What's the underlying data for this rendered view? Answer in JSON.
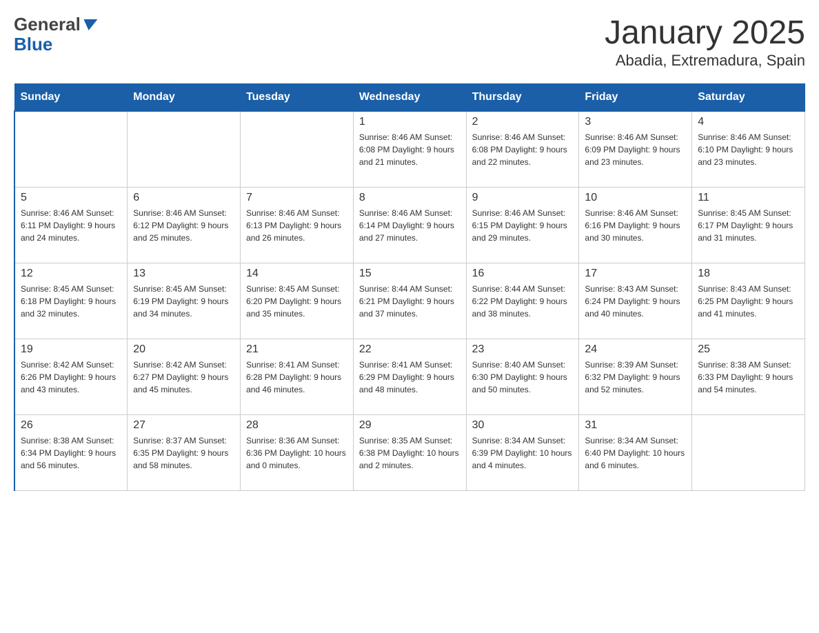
{
  "header": {
    "logo_general": "General",
    "logo_blue": "Blue",
    "title": "January 2025",
    "subtitle": "Abadia, Extremadura, Spain"
  },
  "days_of_week": [
    "Sunday",
    "Monday",
    "Tuesday",
    "Wednesday",
    "Thursday",
    "Friday",
    "Saturday"
  ],
  "weeks": [
    [
      {
        "day": "",
        "info": ""
      },
      {
        "day": "",
        "info": ""
      },
      {
        "day": "",
        "info": ""
      },
      {
        "day": "1",
        "info": "Sunrise: 8:46 AM\nSunset: 6:08 PM\nDaylight: 9 hours and 21 minutes."
      },
      {
        "day": "2",
        "info": "Sunrise: 8:46 AM\nSunset: 6:08 PM\nDaylight: 9 hours and 22 minutes."
      },
      {
        "day": "3",
        "info": "Sunrise: 8:46 AM\nSunset: 6:09 PM\nDaylight: 9 hours and 23 minutes."
      },
      {
        "day": "4",
        "info": "Sunrise: 8:46 AM\nSunset: 6:10 PM\nDaylight: 9 hours and 23 minutes."
      }
    ],
    [
      {
        "day": "5",
        "info": "Sunrise: 8:46 AM\nSunset: 6:11 PM\nDaylight: 9 hours and 24 minutes."
      },
      {
        "day": "6",
        "info": "Sunrise: 8:46 AM\nSunset: 6:12 PM\nDaylight: 9 hours and 25 minutes."
      },
      {
        "day": "7",
        "info": "Sunrise: 8:46 AM\nSunset: 6:13 PM\nDaylight: 9 hours and 26 minutes."
      },
      {
        "day": "8",
        "info": "Sunrise: 8:46 AM\nSunset: 6:14 PM\nDaylight: 9 hours and 27 minutes."
      },
      {
        "day": "9",
        "info": "Sunrise: 8:46 AM\nSunset: 6:15 PM\nDaylight: 9 hours and 29 minutes."
      },
      {
        "day": "10",
        "info": "Sunrise: 8:46 AM\nSunset: 6:16 PM\nDaylight: 9 hours and 30 minutes."
      },
      {
        "day": "11",
        "info": "Sunrise: 8:45 AM\nSunset: 6:17 PM\nDaylight: 9 hours and 31 minutes."
      }
    ],
    [
      {
        "day": "12",
        "info": "Sunrise: 8:45 AM\nSunset: 6:18 PM\nDaylight: 9 hours and 32 minutes."
      },
      {
        "day": "13",
        "info": "Sunrise: 8:45 AM\nSunset: 6:19 PM\nDaylight: 9 hours and 34 minutes."
      },
      {
        "day": "14",
        "info": "Sunrise: 8:45 AM\nSunset: 6:20 PM\nDaylight: 9 hours and 35 minutes."
      },
      {
        "day": "15",
        "info": "Sunrise: 8:44 AM\nSunset: 6:21 PM\nDaylight: 9 hours and 37 minutes."
      },
      {
        "day": "16",
        "info": "Sunrise: 8:44 AM\nSunset: 6:22 PM\nDaylight: 9 hours and 38 minutes."
      },
      {
        "day": "17",
        "info": "Sunrise: 8:43 AM\nSunset: 6:24 PM\nDaylight: 9 hours and 40 minutes."
      },
      {
        "day": "18",
        "info": "Sunrise: 8:43 AM\nSunset: 6:25 PM\nDaylight: 9 hours and 41 minutes."
      }
    ],
    [
      {
        "day": "19",
        "info": "Sunrise: 8:42 AM\nSunset: 6:26 PM\nDaylight: 9 hours and 43 minutes."
      },
      {
        "day": "20",
        "info": "Sunrise: 8:42 AM\nSunset: 6:27 PM\nDaylight: 9 hours and 45 minutes."
      },
      {
        "day": "21",
        "info": "Sunrise: 8:41 AM\nSunset: 6:28 PM\nDaylight: 9 hours and 46 minutes."
      },
      {
        "day": "22",
        "info": "Sunrise: 8:41 AM\nSunset: 6:29 PM\nDaylight: 9 hours and 48 minutes."
      },
      {
        "day": "23",
        "info": "Sunrise: 8:40 AM\nSunset: 6:30 PM\nDaylight: 9 hours and 50 minutes."
      },
      {
        "day": "24",
        "info": "Sunrise: 8:39 AM\nSunset: 6:32 PM\nDaylight: 9 hours and 52 minutes."
      },
      {
        "day": "25",
        "info": "Sunrise: 8:38 AM\nSunset: 6:33 PM\nDaylight: 9 hours and 54 minutes."
      }
    ],
    [
      {
        "day": "26",
        "info": "Sunrise: 8:38 AM\nSunset: 6:34 PM\nDaylight: 9 hours and 56 minutes."
      },
      {
        "day": "27",
        "info": "Sunrise: 8:37 AM\nSunset: 6:35 PM\nDaylight: 9 hours and 58 minutes."
      },
      {
        "day": "28",
        "info": "Sunrise: 8:36 AM\nSunset: 6:36 PM\nDaylight: 10 hours and 0 minutes."
      },
      {
        "day": "29",
        "info": "Sunrise: 8:35 AM\nSunset: 6:38 PM\nDaylight: 10 hours and 2 minutes."
      },
      {
        "day": "30",
        "info": "Sunrise: 8:34 AM\nSunset: 6:39 PM\nDaylight: 10 hours and 4 minutes."
      },
      {
        "day": "31",
        "info": "Sunrise: 8:34 AM\nSunset: 6:40 PM\nDaylight: 10 hours and 6 minutes."
      },
      {
        "day": "",
        "info": ""
      }
    ]
  ]
}
